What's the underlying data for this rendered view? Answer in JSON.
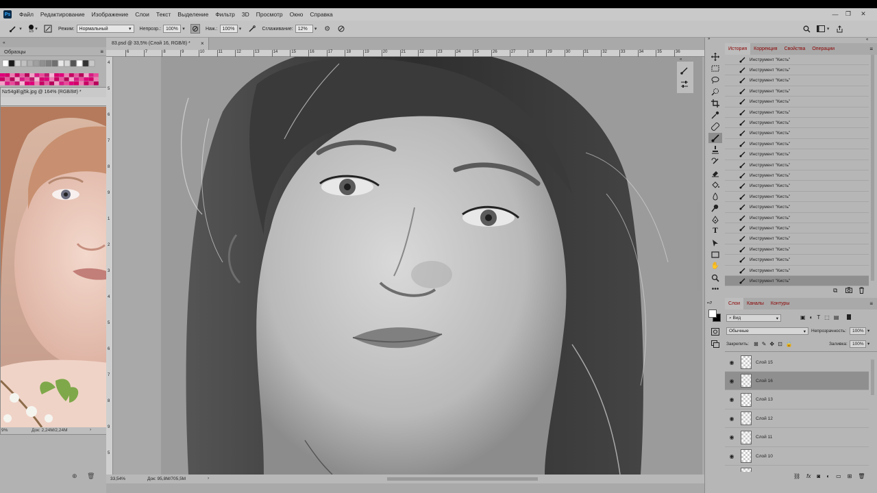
{
  "app": {
    "logo": "Ps"
  },
  "menu": [
    "Файл",
    "Редактирование",
    "Изображение",
    "Слои",
    "Текст",
    "Выделение",
    "Фильтр",
    "3D",
    "Просмотр",
    "Окно",
    "Справка"
  ],
  "window_controls": {
    "minimize": "—",
    "restore": "❐",
    "close": "✕"
  },
  "options": {
    "brush_size": "15",
    "mode_label": "Режим:",
    "mode_value": "Нормальный",
    "opacity_label": "Непрозр.:",
    "opacity_value": "100%",
    "pressure_label": "Наж.:",
    "pressure_value": "100%",
    "smoothing_label": "Сглаживание:",
    "smoothing_value": "12%"
  },
  "left_panel": {
    "tab": "Образцы"
  },
  "swatch_colors": [
    "#ffffff",
    "#1a1a1a",
    "#cfcfcf",
    "#c0c0c0",
    "#b0b0b0",
    "#a0a0a0",
    "#909090",
    "#808080",
    "#707070",
    "#e8e8e8",
    "#d8d8d8",
    "#555555",
    "#ffffff",
    "#333333",
    "#c8c8c8",
    "#222222"
  ],
  "swatch_pink": [
    "#e0007a",
    "#d4006a",
    "#f07cb4",
    "#c80063",
    "#e85aa0",
    "#b8005a",
    "#f5a0c8",
    "#d81b84",
    "#ea4a9a",
    "#c2186f",
    "#f8b4d4",
    "#d8006e",
    "#e0007a",
    "#f07cb4",
    "#c80063",
    "#e85aa0",
    "#b8005a",
    "#f5a0c8",
    "#d81b84",
    "#ea4a9a"
  ],
  "ref_doc": {
    "title": "Nz54giEgj5k.jpg @ 164% (RGB/8#) *",
    "zoom": "9%",
    "size": "Док: 2,24M/2,24M"
  },
  "main_doc": {
    "tab": "83.psd @ 33,5% (Слой 16, RGB/8) *",
    "zoom": "33,54%",
    "size": "Док: 95,8M/705,5M"
  },
  "ruler_h": [
    "6",
    "7",
    "8",
    "9",
    "10",
    "11",
    "12",
    "13",
    "14",
    "15",
    "16",
    "17",
    "18",
    "19",
    "20",
    "21",
    "22",
    "23",
    "24",
    "25",
    "26",
    "27",
    "28",
    "29",
    "30",
    "31",
    "32",
    "33",
    "34",
    "35",
    "36"
  ],
  "ruler_v": [
    "4",
    "5",
    "6",
    "7",
    "8",
    "9",
    "1",
    "2",
    "3",
    "4",
    "5",
    "6",
    "7",
    "8",
    "9",
    "5"
  ],
  "ref_ruler_v": [
    "1",
    "2",
    "3",
    "4",
    "5"
  ],
  "toolbar_icons": [
    "move-icon",
    "marquee-icon",
    "lasso-icon",
    "quick-select-icon",
    "crop-icon",
    "eyedropper-icon",
    "healing-icon",
    "brush-icon",
    "stamp-icon",
    "history-brush-icon",
    "eraser-icon",
    "bucket-icon",
    "blur-icon",
    "dodge-icon",
    "pen-icon",
    "type-icon",
    "path-select-icon",
    "shape-icon",
    "hand-icon",
    "zoom-icon",
    "more-icon"
  ],
  "history_panel": {
    "tabs": [
      "История",
      "Коррекция",
      "Свойства",
      "Операции"
    ],
    "items": [
      "Инструмент \"Кисть\"",
      "Инструмент \"Кисть\"",
      "Инструмент \"Кисть\"",
      "Инструмент \"Кисть\"",
      "Инструмент \"Кисть\"",
      "Инструмент \"Кисть\"",
      "Инструмент \"Кисть\"",
      "Инструмент \"Кисть\"",
      "Инструмент \"Кисть\"",
      "Инструмент \"Кисть\"",
      "Инструмент \"Кисть\"",
      "Инструмент \"Кисть\"",
      "Инструмент \"Кисть\"",
      "Инструмент \"Кисть\"",
      "Инструмент \"Кисть\"",
      "Инструмент \"Кисть\"",
      "Инструмент \"Кисть\"",
      "Инструмент \"Кисть\"",
      "Инструмент \"Кисть\"",
      "Инструмент \"Кисть\"",
      "Инструмент \"Кисть\"",
      "Инструмент \"Кисть\""
    ]
  },
  "layers_panel": {
    "tabs": [
      "Слои",
      "Каналы",
      "Контуры"
    ],
    "filter_label": "Вид",
    "blend_mode": "Обычные",
    "opacity_label": "Непрозрачность:",
    "opacity_value": "100%",
    "lock_label": "Закрепить:",
    "fill_label": "Заливка:",
    "fill_value": "100%",
    "layers": [
      "Слой 15",
      "Слой 16",
      "Слой 13",
      "Слой 12",
      "Слой 11",
      "Слой 10"
    ],
    "selected_index": 1
  }
}
